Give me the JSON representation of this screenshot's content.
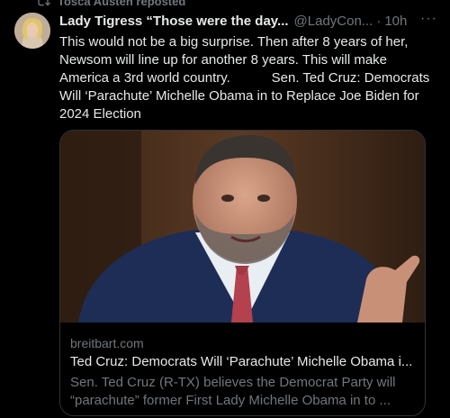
{
  "repost": {
    "label": "Tosca Austen reposted",
    "icon": "repost-icon"
  },
  "tweet": {
    "display_name": "Lady Tigress “Those were the day...",
    "handle": "@LadyCon...",
    "separator": "·",
    "time": "10h",
    "more": "···",
    "text": "This would not be a big surprise. Then after 8 years of her, Newsom will line up for another 8 years. This will make America a 3rd world country.           Sen. Ted Cruz: Democrats Will ‘Parachute’ Michelle Obama in to Replace Joe Biden for 2024 Election"
  },
  "card": {
    "domain": "breitbart.com",
    "title": "Ted Cruz: Democrats Will ‘Parachute’ Michelle Obama i...",
    "description": "Sen. Ted Cruz (R-TX) believes the Democrat Party will “parachute” former First Lady Michelle Obama in to ..."
  },
  "colors": {
    "background": "#000000",
    "text_primary": "#e7e9ea",
    "text_secondary": "#71767b",
    "border": "#2f3336"
  }
}
